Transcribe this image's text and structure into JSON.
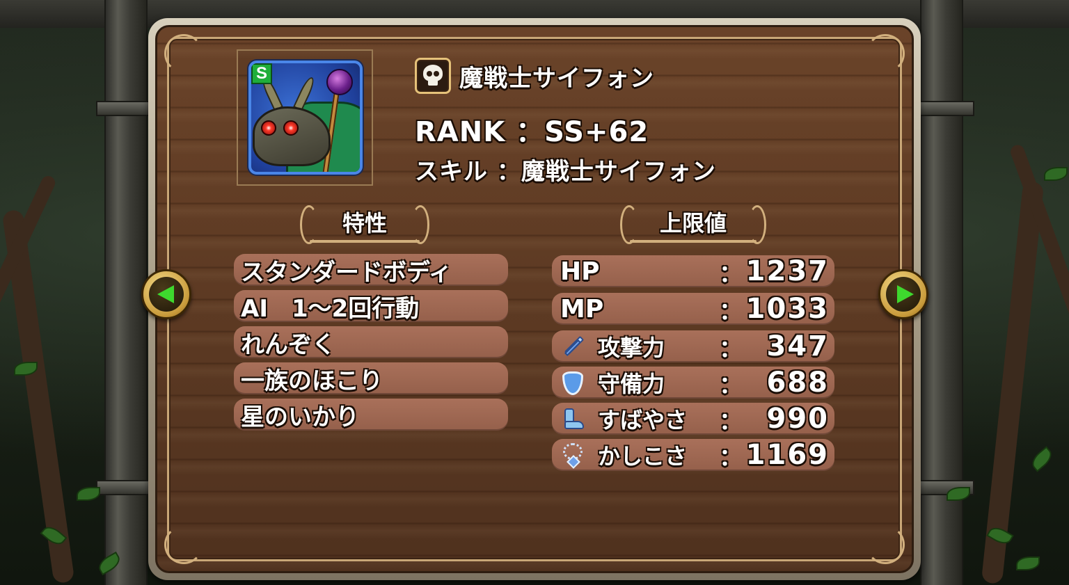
{
  "monster": {
    "name": "魔戦士サイフォン",
    "rank_badge": "S",
    "rank_text": "RANK ：SS+62",
    "skill_text": "スキル ：魔戦士サイフォン",
    "type_icon": "skull-icon"
  },
  "sections": {
    "traits_title": "特性",
    "limits_title": "上限値"
  },
  "traits": [
    "スタンダードボディ",
    "AI　1～2回行動",
    "れんぞく",
    "一族のほこり",
    "星のいかり"
  ],
  "stats": {
    "hp": {
      "label": "HP",
      "value": "1237"
    },
    "mp": {
      "label": "MP",
      "value": "1033"
    },
    "attack": {
      "label": "攻撃力",
      "value": "347",
      "icon": "sword-icon"
    },
    "defense": {
      "label": "守備力",
      "value": "688",
      "icon": "shield-icon"
    },
    "agility": {
      "label": "すばやさ",
      "value": "990",
      "icon": "boot-icon"
    },
    "wisdom": {
      "label": "かしこさ",
      "value": "1169",
      "icon": "necklace-icon"
    },
    "colon": "："
  },
  "colors": {
    "panel_wood": "#5d3a23",
    "row_fill": "#a9705a",
    "accent_gold": "#d2b07e",
    "nav_arrow": "#3ed82e",
    "rank_badge": "#1fae3a"
  }
}
